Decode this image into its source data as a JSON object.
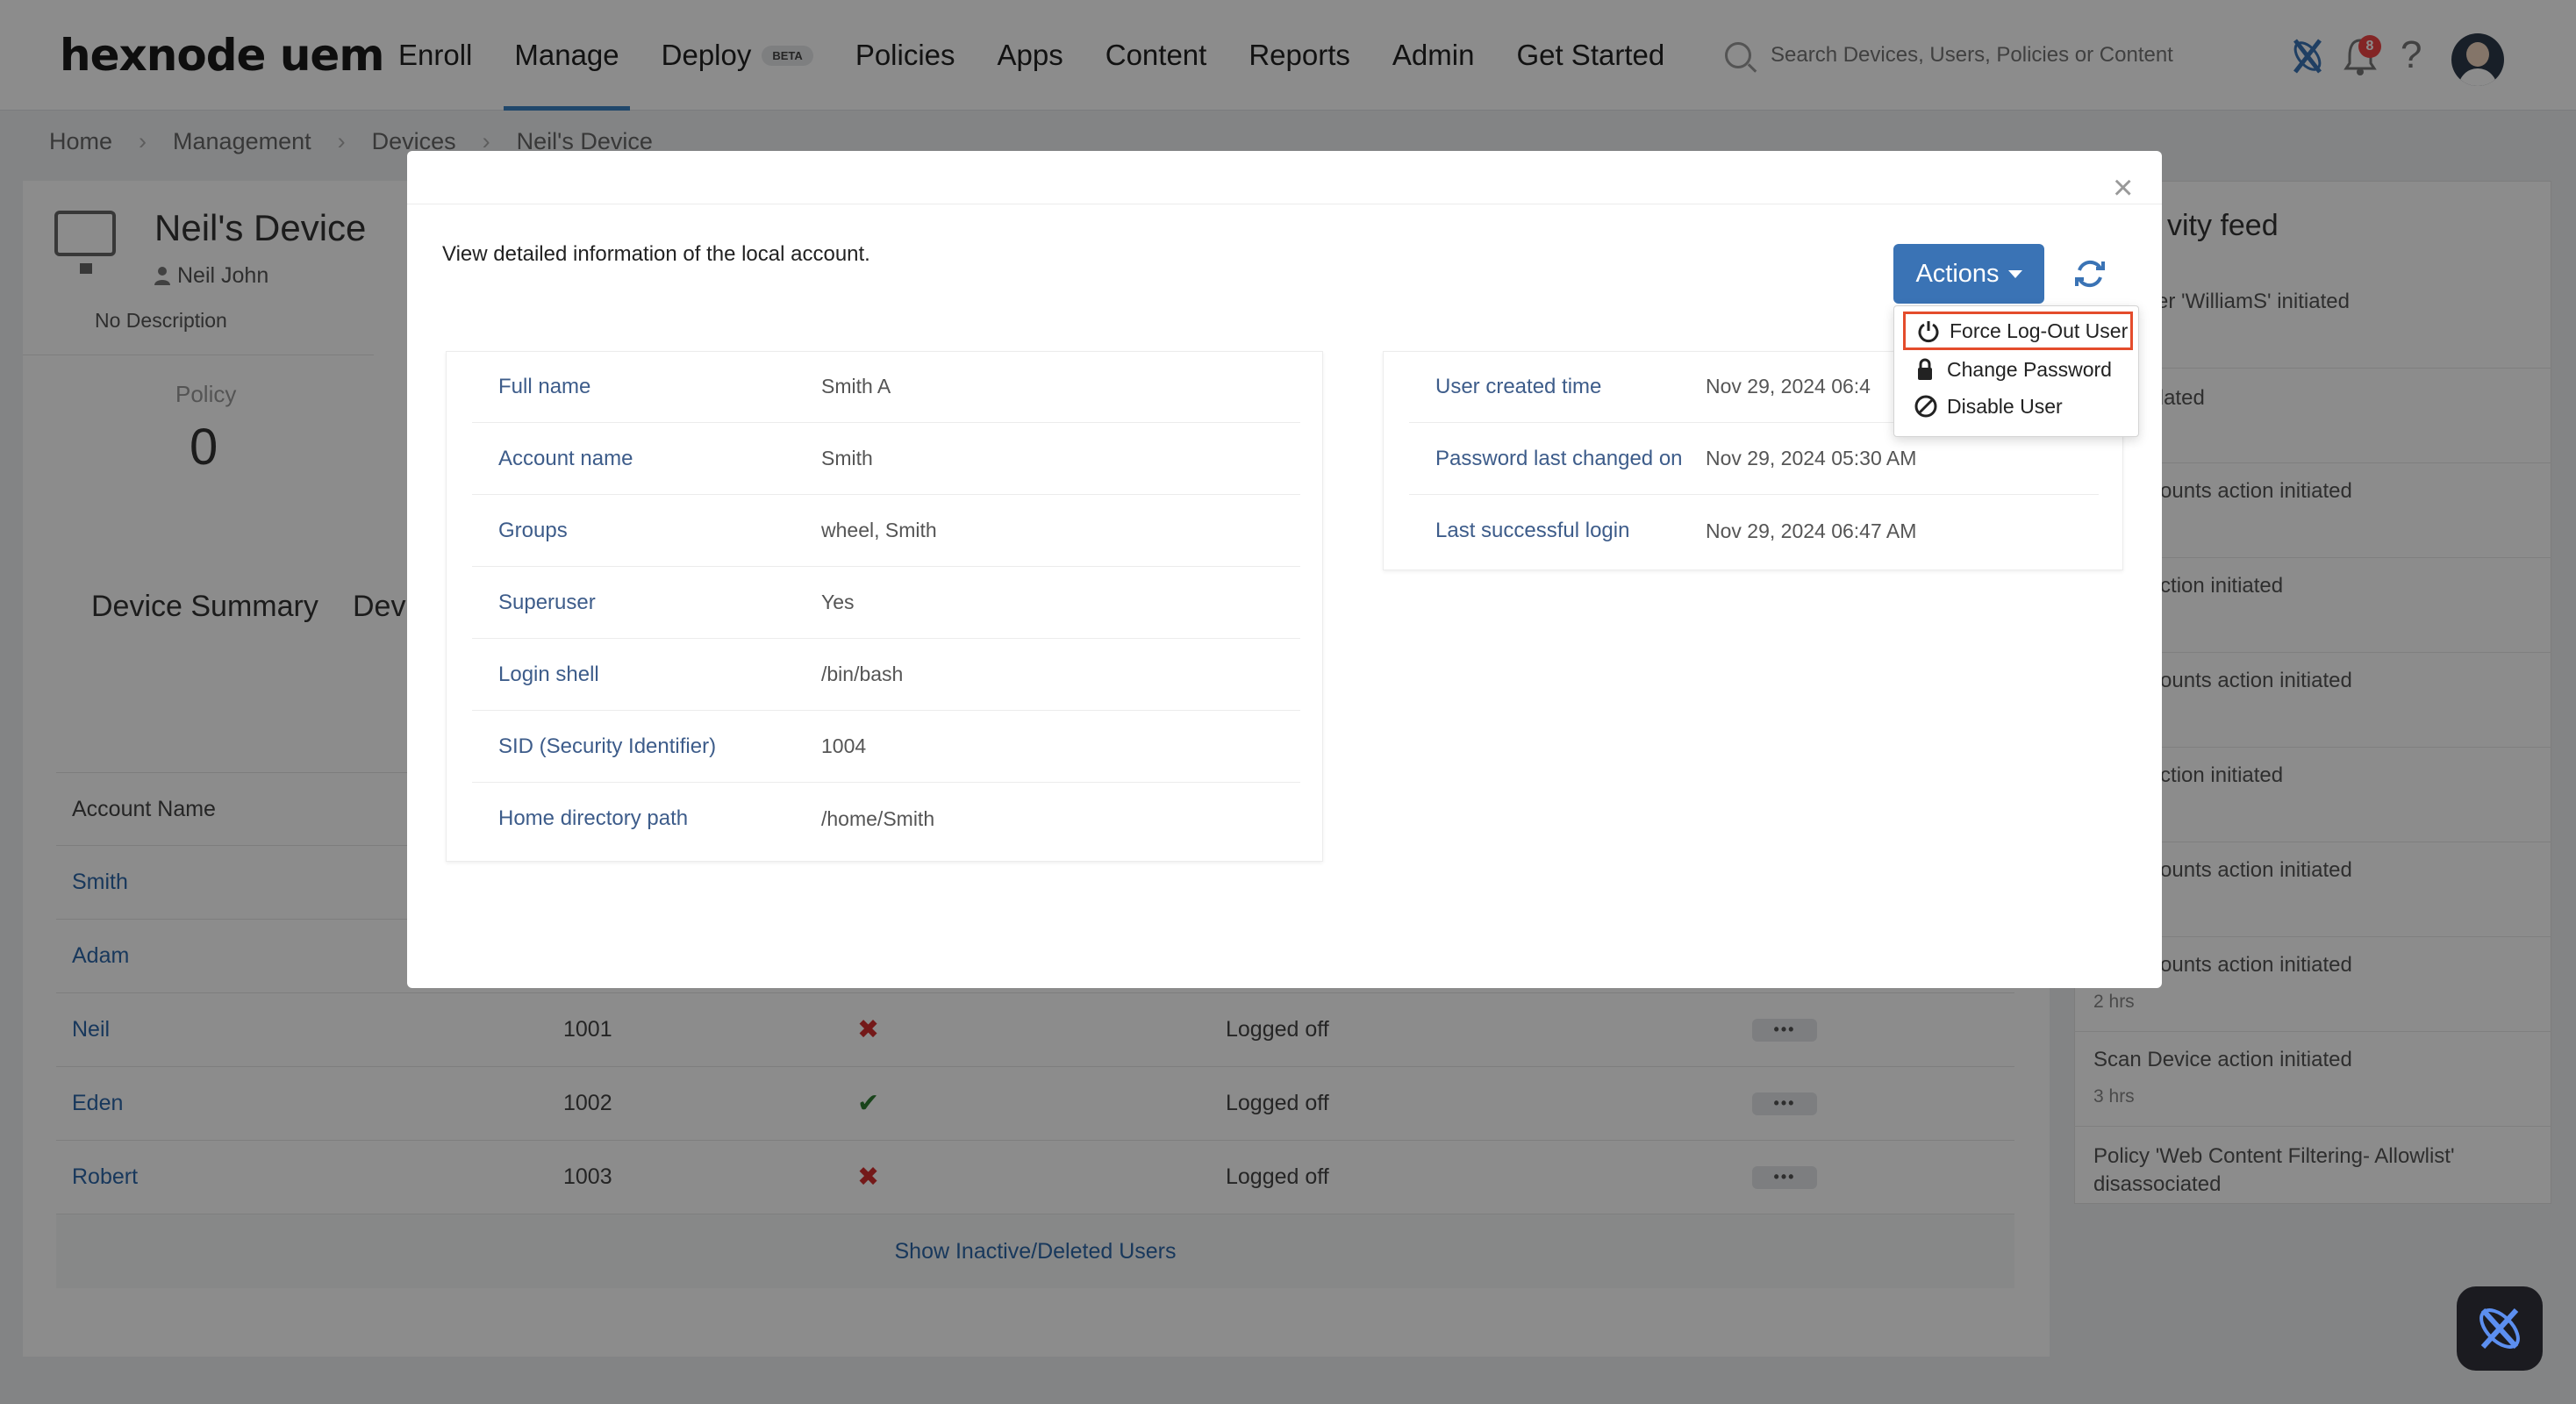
{
  "header": {
    "logo": "hexnode uem",
    "nav": [
      {
        "label": "Enroll"
      },
      {
        "label": "Manage"
      },
      {
        "label": "Deploy",
        "badge": "BETA"
      },
      {
        "label": "Policies"
      },
      {
        "label": "Apps"
      },
      {
        "label": "Content"
      },
      {
        "label": "Reports"
      },
      {
        "label": "Admin"
      },
      {
        "label": "Get Started"
      }
    ],
    "search_placeholder": "Search Devices, Users, Policies or Content",
    "notification_count": "8",
    "help": "?"
  },
  "breadcrumb": [
    "Home",
    "Management",
    "Devices",
    "Neil's Device"
  ],
  "device": {
    "title": "Neil's Device",
    "user": "Neil John",
    "description": "No Description",
    "policy_label": "Policy",
    "policy_value": "0"
  },
  "tabs": {
    "summary": "Device Summary",
    "second": "Dev"
  },
  "table": {
    "headers": [
      "Account Name"
    ],
    "rows": [
      {
        "name": "Smith",
        "id": "",
        "status": "",
        "state": ""
      },
      {
        "name": "Adam",
        "id": "",
        "status": "",
        "state": ""
      },
      {
        "name": "Neil",
        "id": "1001",
        "status": "x",
        "state": "Logged off"
      },
      {
        "name": "Eden",
        "id": "1002",
        "status": "check",
        "state": "Logged off"
      },
      {
        "name": "Robert",
        "id": "1003",
        "status": "x",
        "state": "Logged off"
      }
    ],
    "show_inactive": "Show Inactive/Deleted Users"
  },
  "feed": {
    "title": "vity feed",
    "items": [
      {
        "text": "n of user 'WilliamS' initiated",
        "time": ""
      },
      {
        "text": "nfo updated",
        "time": ""
      },
      {
        "text": "cal Accounts action initiated",
        "time": ""
      },
      {
        "text": "evice action initiated",
        "time": ""
      },
      {
        "text": "cal Accounts action initiated",
        "time": ""
      },
      {
        "text": "evice action initiated",
        "time": ""
      },
      {
        "text": "cal Accounts action initiated",
        "time": ""
      },
      {
        "text": "cal Accounts action initiated",
        "time": "2 hrs"
      },
      {
        "text": "Scan Device action initiated",
        "time": "3 hrs"
      },
      {
        "text": "Policy 'Web Content Filtering- Allowlist' disassociated",
        "time": ""
      }
    ]
  },
  "modal": {
    "description": "View detailed information of the local account.",
    "actions_label": "Actions",
    "close": "×",
    "dropdown": [
      {
        "label": "Force Log-Out User",
        "icon": "power-icon"
      },
      {
        "label": "Change Password",
        "icon": "lock-icon"
      },
      {
        "label": "Disable User",
        "icon": "ban-icon"
      }
    ],
    "left_fields": [
      {
        "key": "Full name",
        "value": "Smith A"
      },
      {
        "key": "Account name",
        "value": "Smith"
      },
      {
        "key": "Groups",
        "value": "wheel, Smith"
      },
      {
        "key": "Superuser",
        "value": "Yes"
      },
      {
        "key": "Login shell",
        "value": "/bin/bash"
      },
      {
        "key": "SID (Security Identifier)",
        "value": "1004"
      },
      {
        "key": "Home directory path",
        "value": "/home/Smith"
      }
    ],
    "right_fields": [
      {
        "key": "User created time",
        "value": "Nov 29, 2024 06:4"
      },
      {
        "key": "Password last changed on",
        "value": "Nov 29, 2024 05:30 AM"
      },
      {
        "key": "Last successful login",
        "value": "Nov 29, 2024 06:47 AM"
      }
    ]
  },
  "colors": {
    "accent": "#3a73b5",
    "link": "#2c66a8",
    "highlight": "#e44c2c"
  }
}
